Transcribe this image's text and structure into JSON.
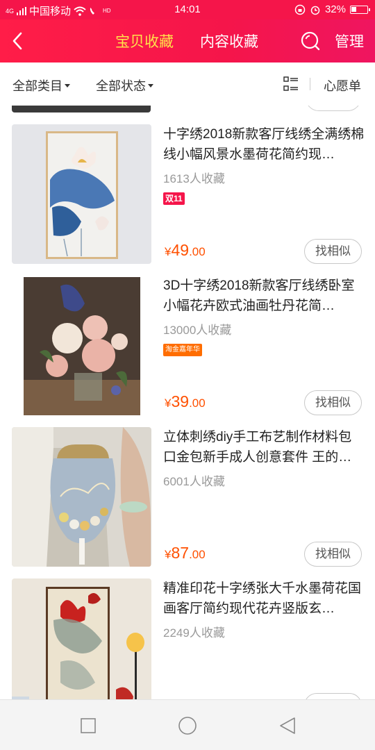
{
  "status_bar": {
    "network": "4G",
    "carrier": "中国移动",
    "hd": "HD",
    "time": "14:01",
    "battery": "32%"
  },
  "header": {
    "tabs": [
      {
        "label": "宝贝收藏",
        "active": true
      },
      {
        "label": "内容收藏",
        "active": false
      }
    ],
    "manage_label": "管理",
    "accent_color": "#f5154a",
    "active_tab_color": "#ffe34a"
  },
  "filters": {
    "category": "全部类目",
    "status": "全部状态",
    "wishlist": "心愿单"
  },
  "items": [
    {
      "title": "十字绣2018新款客厅线绣全满绣棉线小幅风景水墨荷花简约现…",
      "favorites": "1613人收藏",
      "tag": "双11",
      "price_currency": "¥",
      "price_int": "49",
      "price_dec": ".00",
      "similar_label": "找相似"
    },
    {
      "title": "3D十字绣2018新款客厅线绣卧室小幅花卉欧式油画牡丹花简…",
      "favorites": "13000人收藏",
      "tag": "淘金嘉年华",
      "price_currency": "¥",
      "price_int": "39",
      "price_dec": ".00",
      "similar_label": "找相似"
    },
    {
      "title": "立体刺绣diy手工布艺制作材料包口金包新手成人创意套件 王的…",
      "favorites": "6001人收藏",
      "tag": "",
      "price_currency": "¥",
      "price_int": "87",
      "price_dec": ".00",
      "similar_label": "找相似"
    },
    {
      "title": "精准印花十字绣张大千水墨荷花国画客厅简约现代花卉竖版玄…",
      "favorites": "2249人收藏",
      "tag": "",
      "price_currency": "",
      "price_int": "",
      "price_dec": "",
      "similar_label": ""
    }
  ]
}
